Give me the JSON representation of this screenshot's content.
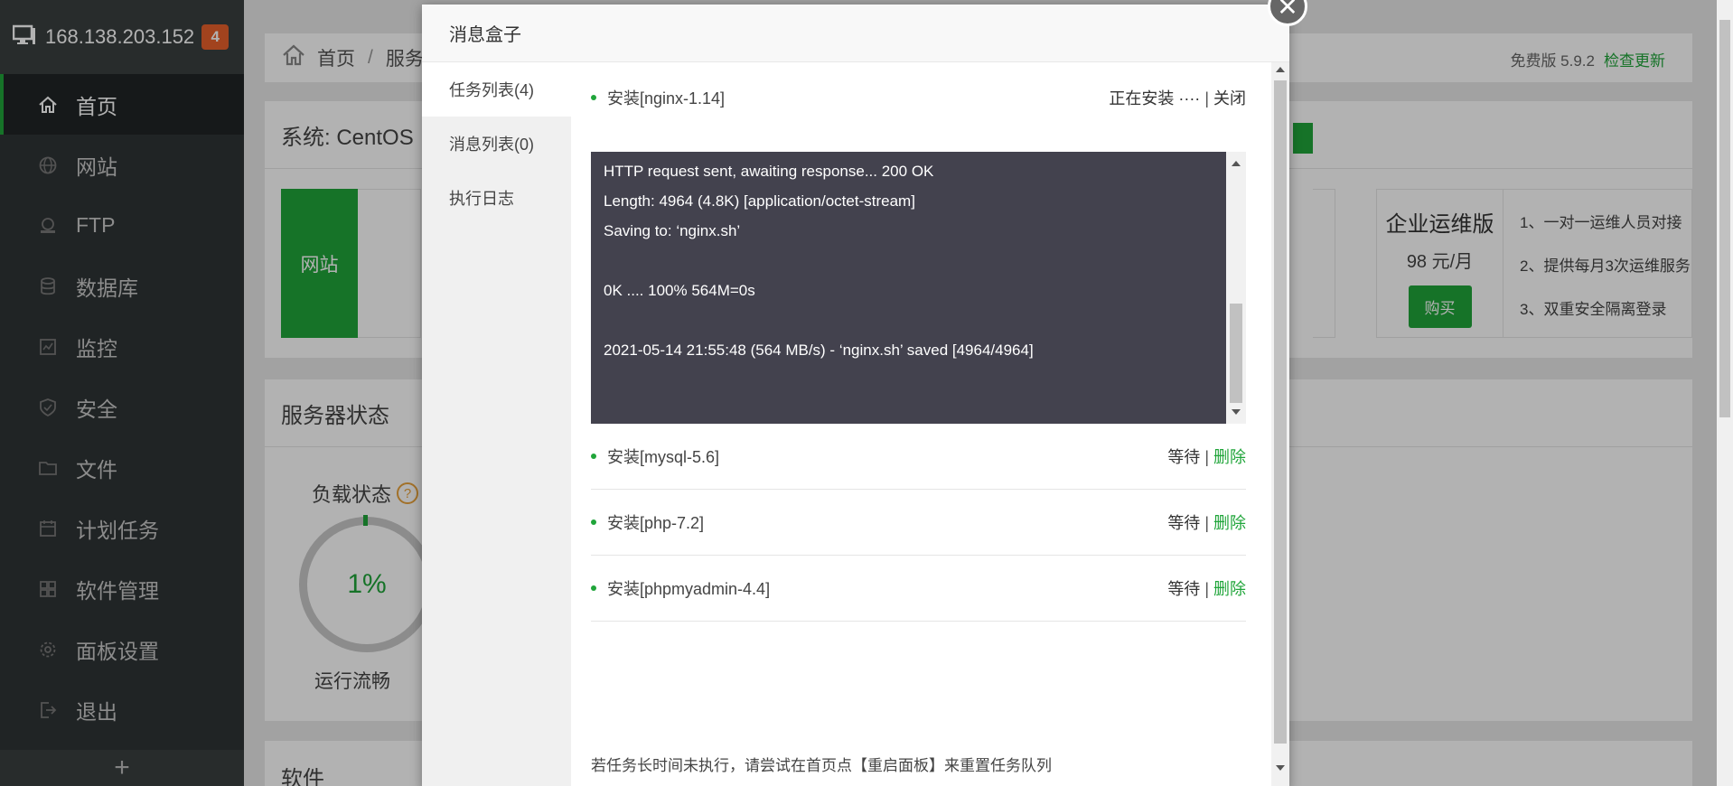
{
  "sidebar": {
    "server_ip": "168.138.203.152",
    "badge": "4",
    "items": [
      {
        "label": "首页",
        "icon": "home-icon"
      },
      {
        "label": "网站",
        "icon": "globe-icon"
      },
      {
        "label": "FTP",
        "icon": "ftp-icon"
      },
      {
        "label": "数据库",
        "icon": "database-icon"
      },
      {
        "label": "监控",
        "icon": "monitor-icon"
      },
      {
        "label": "安全",
        "icon": "shield-icon"
      },
      {
        "label": "文件",
        "icon": "folder-icon"
      },
      {
        "label": "计划任务",
        "icon": "calendar-icon"
      },
      {
        "label": "软件管理",
        "icon": "grid-icon"
      },
      {
        "label": "面板设置",
        "icon": "gear-icon"
      },
      {
        "label": "退出",
        "icon": "logout-icon"
      }
    ],
    "add": "+"
  },
  "header": {
    "crumb_home": "首页",
    "crumb_sep": "/",
    "crumb_current": "服务",
    "version": "免费版 5.9.2",
    "update_link": "检查更新"
  },
  "system": {
    "title": "系统: CentOS",
    "site_tile": "网站"
  },
  "enterprise": {
    "name": "企业运维版",
    "price": "98 元/月",
    "buy": "购买",
    "features": [
      "1、一对一运维人员对接",
      "2、提供每月3次运维服务",
      "3、双重安全隔离登录"
    ]
  },
  "status": {
    "title": "服务器状态",
    "load_label": "负载状态",
    "help": "?",
    "load_value": "1%",
    "load_fraction": 0.01,
    "run_text": "运行流畅"
  },
  "software": {
    "title": "软件"
  },
  "modal": {
    "title": "消息盒子",
    "close": "✕",
    "tabs": [
      "任务列表(4)",
      "消息列表(0)",
      "执行日志"
    ],
    "active_task": {
      "name": "安装[nginx-1.14]",
      "status": "正在安装 ····",
      "sep": "|",
      "action": "关闭"
    },
    "log_lines": [
      "HTTP request sent, awaiting response... 200 OK",
      "Length: 4964 (4.8K) [application/octet-stream]",
      "Saving to: ‘nginx.sh’",
      "",
      "0K .... 100% 564M=0s",
      "",
      "2021-05-14 21:55:48 (564 MB/s) - ‘nginx.sh’ saved [4964/4964]"
    ],
    "queued_tasks": [
      {
        "name": "安装[mysql-5.6]",
        "status": "等待",
        "sep": "|",
        "action": "删除"
      },
      {
        "name": "安装[php-7.2]",
        "status": "等待",
        "sep": "|",
        "action": "删除"
      },
      {
        "name": "安装[phpmyadmin-4.4]",
        "status": "等待",
        "sep": "|",
        "action": "删除"
      }
    ],
    "hint": "若任务长时间未执行，请尝试在首页点【重启面板】来重置任务队列"
  }
}
